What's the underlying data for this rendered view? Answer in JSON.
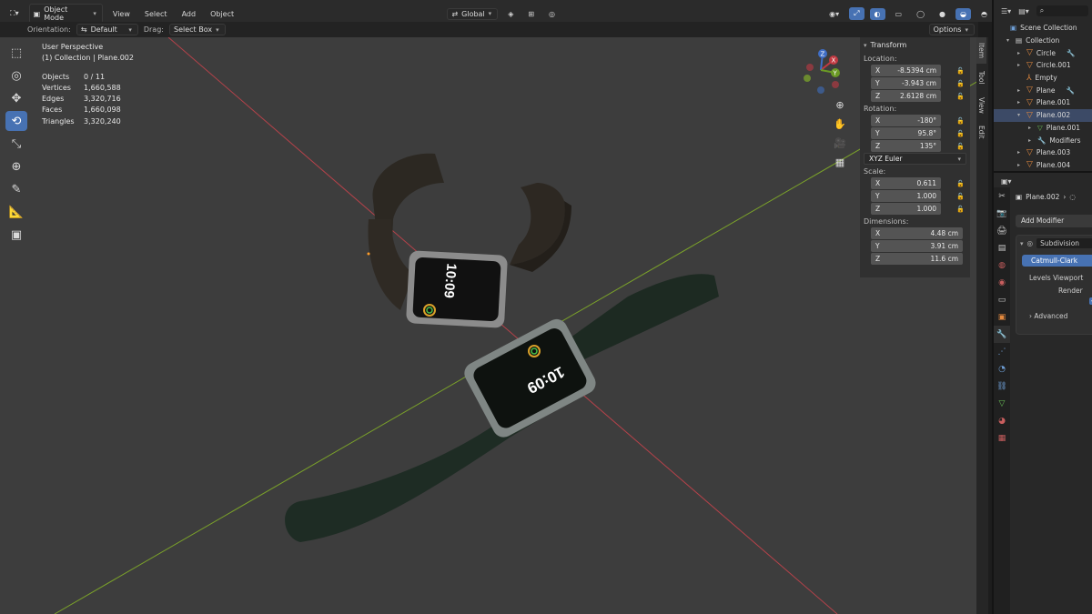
{
  "header": {
    "mode": "Object Mode",
    "menus": [
      "View",
      "Select",
      "Add",
      "Object"
    ],
    "transform_orientation": "Global"
  },
  "tool_settings": {
    "orientation_label": "Orientation:",
    "orientation_value": "Default",
    "drag_label": "Drag:",
    "drag_value": "Select Box",
    "options": "Options"
  },
  "viewport": {
    "perspective": "User Perspective",
    "context": "(1) Collection | Plane.002",
    "stats": [
      {
        "label": "Objects",
        "value": "0 / 11"
      },
      {
        "label": "Vertices",
        "value": "1,660,588"
      },
      {
        "label": "Edges",
        "value": "3,320,716"
      },
      {
        "label": "Faces",
        "value": "1,660,098"
      },
      {
        "label": "Triangles",
        "value": "3,320,240"
      }
    ],
    "watch_time": "10:09"
  },
  "n_panel": {
    "title": "Transform",
    "location_label": "Location:",
    "location": [
      {
        "axis": "X",
        "value": "-8.5394 cm"
      },
      {
        "axis": "Y",
        "value": "-3.943 cm"
      },
      {
        "axis": "Z",
        "value": "2.6128 cm"
      }
    ],
    "rotation_label": "Rotation:",
    "rotation": [
      {
        "axis": "X",
        "value": "-180°"
      },
      {
        "axis": "Y",
        "value": "95.8°"
      },
      {
        "axis": "Z",
        "value": "135°"
      }
    ],
    "rotation_mode": "XYZ Euler",
    "scale_label": "Scale:",
    "scale": [
      {
        "axis": "X",
        "value": "0.611"
      },
      {
        "axis": "Y",
        "value": "1.000"
      },
      {
        "axis": "Z",
        "value": "1.000"
      }
    ],
    "dimensions_label": "Dimensions:",
    "dimensions": [
      {
        "axis": "X",
        "value": "4.48 cm"
      },
      {
        "axis": "Y",
        "value": "3.91 cm"
      },
      {
        "axis": "Z",
        "value": "11.6 cm"
      }
    ],
    "tabs": [
      "Item",
      "Tool",
      "View",
      "Edit"
    ]
  },
  "outliner": {
    "rows": [
      {
        "label": "Scene Collection",
        "indent": 0,
        "icon": "scene-collection-icon"
      },
      {
        "label": "Collection",
        "indent": 1,
        "icon": "collection-icon"
      },
      {
        "label": "Circle",
        "indent": 2,
        "icon": "object-icon"
      },
      {
        "label": "Circle.001",
        "indent": 2,
        "icon": "object-icon"
      },
      {
        "label": "Empty",
        "indent": 2,
        "icon": "empty-icon"
      },
      {
        "label": "Plane",
        "indent": 2,
        "icon": "object-icon"
      },
      {
        "label": "Plane.001",
        "indent": 2,
        "icon": "object-icon"
      },
      {
        "label": "Plane.002",
        "indent": 2,
        "icon": "object-icon",
        "selected": true
      },
      {
        "label": "Plane.001",
        "indent": 3,
        "icon": "mesh-icon"
      },
      {
        "label": "Modifiers",
        "indent": 3,
        "icon": "wrench-icon"
      },
      {
        "label": "Plane.003",
        "indent": 2,
        "icon": "object-icon"
      },
      {
        "label": "Plane.004",
        "indent": 2,
        "icon": "object-icon"
      }
    ]
  },
  "properties": {
    "object_name": "Plane.002",
    "add_modifier": "Add Modifier",
    "modifier_name": "Subdivision",
    "catmull_clark": "Catmull-Clark",
    "levels_viewport": "Levels Viewport",
    "render": "Render",
    "advanced": "Advanced"
  },
  "colors": {
    "accent": "#4772b3",
    "viewport_bg": "#3d3d3d",
    "x_axis": "#b5424a",
    "y_axis": "#7ba22a",
    "object_icon": "#e3893e"
  }
}
